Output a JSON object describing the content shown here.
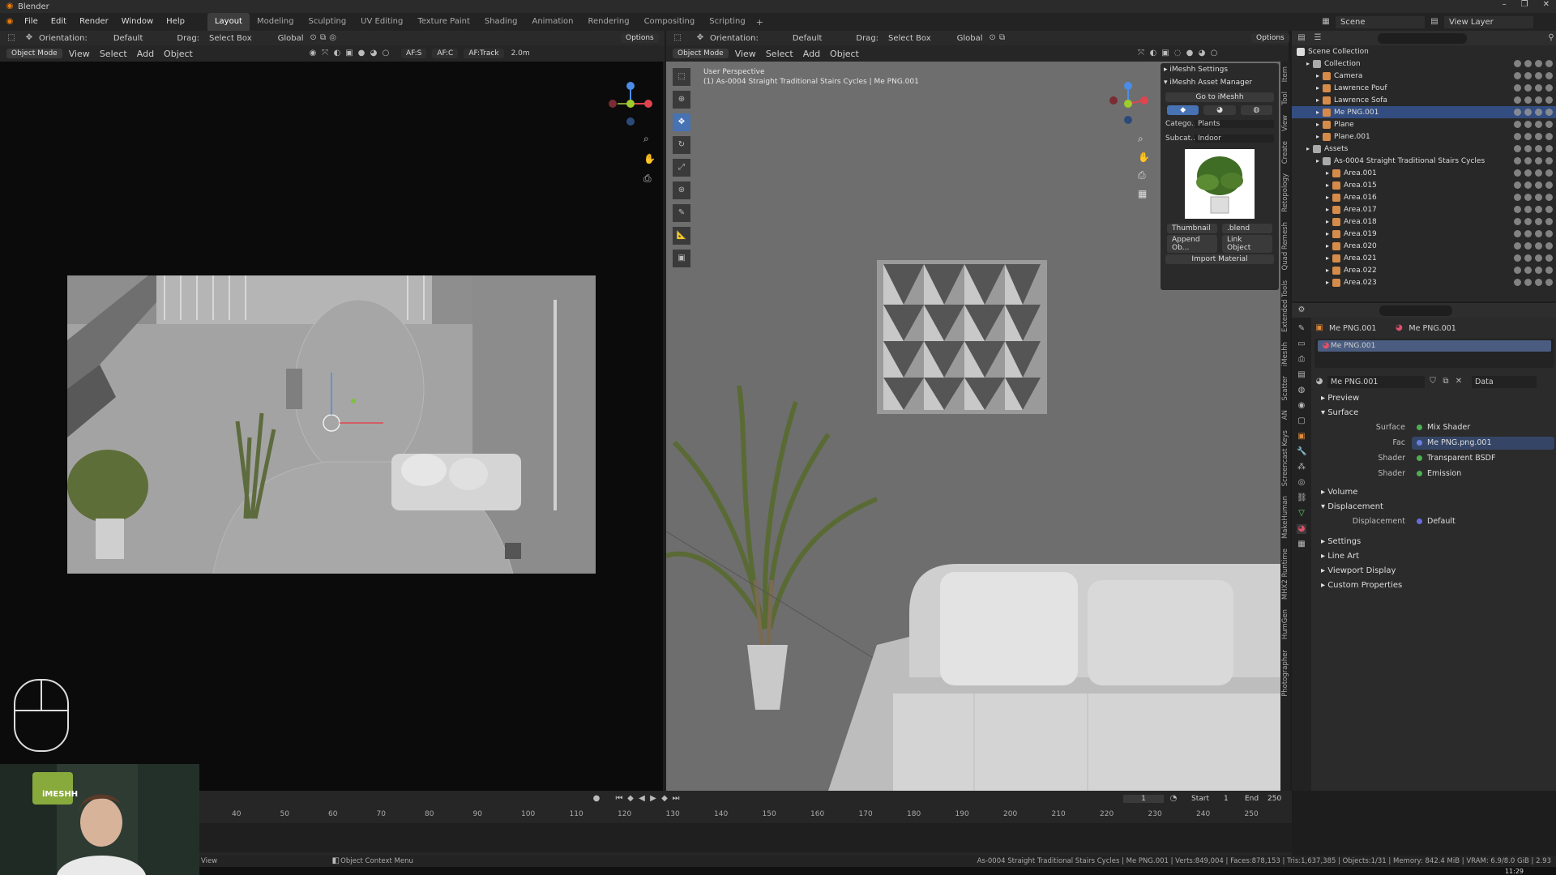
{
  "app": {
    "title": "Blender"
  },
  "menus": [
    "File",
    "Edit",
    "Render",
    "Window",
    "Help"
  ],
  "workspaces": [
    "Layout",
    "Modeling",
    "Sculpting",
    "UV Editing",
    "Texture Paint",
    "Shading",
    "Animation",
    "Rendering",
    "Compositing",
    "Scripting"
  ],
  "active_workspace": "Layout",
  "header_right": {
    "scene_label": "Scene",
    "view_layer_label": "View Layer"
  },
  "left_toolbar": {
    "orientation_label": "Orientation:",
    "orientation_value": "Default",
    "drag_label": "Drag:",
    "drag_value": "Select Box",
    "transform": "Global",
    "options": "Options"
  },
  "left_viewport": {
    "mode": "Object Mode",
    "menus": [
      "View",
      "Select",
      "Add",
      "Object"
    ],
    "af_s": "AF:S",
    "af_c": "AF:C",
    "af_track": "AF:Track",
    "distance": "2.0m"
  },
  "right_toolbar": {
    "orientation_label": "Orientation:",
    "orientation_value": "Default",
    "drag_label": "Drag:",
    "drag_value": "Select Box",
    "transform": "Global",
    "options": "Options"
  },
  "right_viewport": {
    "mode": "Object Mode",
    "menus": [
      "View",
      "Select",
      "Add",
      "Object"
    ],
    "info_line1": "User Perspective",
    "info_line2": "(1) As-0004 Straight Traditional Stairs Cycles | Me PNG.001"
  },
  "imeshh_panel": {
    "settings": "iMeshh Settings",
    "asset_manager": "iMeshh Asset Manager",
    "go_button": "Go to iMeshh",
    "category_label": "Catego...",
    "category_value": "Plants",
    "subcategory_label": "Subcat...",
    "subcategory_value": "Indoor",
    "thumbnail_btn": "Thumbnail",
    "blend_btn": ".blend",
    "append_btn": "Append Ob...",
    "link_btn": "Link Object",
    "import_btn": "Import Material"
  },
  "side_tabs": [
    "Item",
    "Tool",
    "View",
    "Create",
    "Retopology",
    "Quad Remesh",
    "Extended Tools",
    "iMeshh",
    "Scatter",
    "AN",
    "Screencast Keys",
    "MakeHuman",
    "MHX2 Runtime",
    "HumGen",
    "Photographer"
  ],
  "outliner": {
    "title": "Scene Collection",
    "items": [
      {
        "label": "Collection",
        "indent": 1,
        "color": "#aaaaaa"
      },
      {
        "label": "Camera",
        "indent": 2,
        "color": "#d58b4a"
      },
      {
        "label": "Lawrence Pouf",
        "indent": 2,
        "color": "#d58b4a"
      },
      {
        "label": "Lawrence Sofa",
        "indent": 2,
        "color": "#d58b4a"
      },
      {
        "label": "Me PNG.001",
        "indent": 2,
        "color": "#d58b4a",
        "selected": true
      },
      {
        "label": "Plane",
        "indent": 2,
        "color": "#d58b4a"
      },
      {
        "label": "Plane.001",
        "indent": 2,
        "color": "#d58b4a"
      },
      {
        "label": "Assets",
        "indent": 1,
        "color": "#aaaaaa"
      },
      {
        "label": "As-0004 Straight Traditional Stairs Cycles",
        "indent": 2,
        "color": "#aaaaaa"
      },
      {
        "label": "Area.001",
        "indent": 3,
        "color": "#d58b4a"
      },
      {
        "label": "Area.015",
        "indent": 3,
        "color": "#d58b4a"
      },
      {
        "label": "Area.016",
        "indent": 3,
        "color": "#d58b4a"
      },
      {
        "label": "Area.017",
        "indent": 3,
        "color": "#d58b4a"
      },
      {
        "label": "Area.018",
        "indent": 3,
        "color": "#d58b4a"
      },
      {
        "label": "Area.019",
        "indent": 3,
        "color": "#d58b4a"
      },
      {
        "label": "Area.020",
        "indent": 3,
        "color": "#d58b4a"
      },
      {
        "label": "Area.021",
        "indent": 3,
        "color": "#d58b4a"
      },
      {
        "label": "Area.022",
        "indent": 3,
        "color": "#d58b4a"
      },
      {
        "label": "Area.023",
        "indent": 3,
        "color": "#d58b4a"
      }
    ]
  },
  "properties": {
    "breadcrumb_object": "Me PNG.001",
    "breadcrumb_material": "Me PNG.001",
    "material_slot": "Me PNG.001",
    "material_name": "Me PNG.001",
    "data_label": "Data",
    "sections": {
      "preview": "Preview",
      "surface": "Surface",
      "volume": "Volume",
      "displacement": "Displacement",
      "settings": "Settings",
      "line_art": "Line Art",
      "viewport_display": "Viewport Display",
      "custom_properties": "Custom Properties"
    },
    "rows": {
      "surface_label": "Surface",
      "surface_value": "Mix Shader",
      "fac_label": "Fac",
      "fac_value": "Me PNG.png.001",
      "shader1_label": "Shader",
      "shader1_value": "Transparent BSDF",
      "shader2_label": "Shader",
      "shader2_value": "Emission",
      "displacement_label": "Displacement",
      "displacement_value": "Default"
    }
  },
  "timeline": {
    "current_frame": "1",
    "start_label": "Start",
    "start_value": "1",
    "end_label": "End",
    "end_value": "250",
    "ticks": [
      "40",
      "50",
      "60",
      "70",
      "80",
      "90",
      "100",
      "110",
      "120",
      "130",
      "140",
      "150",
      "160",
      "170",
      "180",
      "190",
      "200",
      "210",
      "220",
      "230",
      "240",
      "250"
    ]
  },
  "statusbar": {
    "left": "View",
    "context": "Object Context Menu",
    "right": "As-0004 Straight Traditional Stairs Cycles | Me PNG.001 | Verts:849,004 | Faces:878,153 | Tris:1,637,385 | Objects:1/31 | Memory: 842.4 MiB | VRAM: 6.9/8.0 GiB | 2.93",
    "clock": "11:29"
  },
  "webcam": {
    "logo": "iMESHH"
  }
}
